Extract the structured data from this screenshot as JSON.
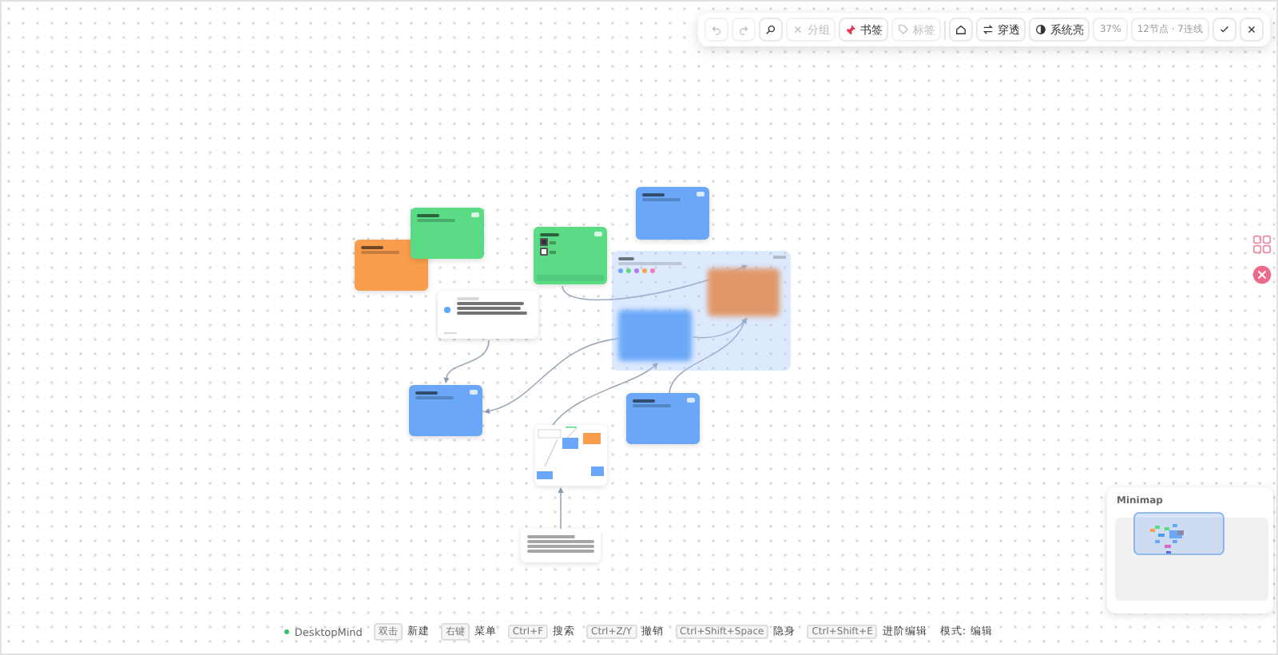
{
  "toolbar": {
    "items": [
      {
        "kind": "icon",
        "disabled": true
      },
      {
        "kind": "icon",
        "disabled": true
      },
      {
        "kind": "icon",
        "disabled": false
      },
      {
        "kind": "text",
        "label": "分组",
        "disabled": true
      },
      {
        "kind": "text",
        "label": "书签",
        "disabled": false
      },
      {
        "kind": "text",
        "label": "标签",
        "disabled": true
      },
      {
        "kind": "icon",
        "disabled": false
      },
      {
        "kind": "text",
        "label": "穿透",
        "disabled": false
      },
      {
        "kind": "text",
        "label": "系统亮",
        "disabled": false
      },
      {
        "kind": "info",
        "label": "37%"
      },
      {
        "kind": "info",
        "label": "12节点 · 7连线"
      },
      {
        "kind": "icon",
        "disabled": false
      },
      {
        "kind": "icon",
        "disabled": false
      }
    ]
  },
  "nodes": [
    {
      "kind": "note",
      "color": "#f79d4b"
    },
    {
      "kind": "note",
      "color": "#5bdb86"
    },
    {
      "kind": "todo",
      "color": "#5bdb86",
      "tasks": [
        {
          "checked": true
        },
        {
          "checked": false
        }
      ]
    },
    {
      "kind": "note",
      "color": "#6aa8f7"
    },
    {
      "kind": "group",
      "swatches": [
        {
          "color": "#6aa8f7"
        },
        {
          "color": "#5bdb86"
        },
        {
          "color": "#b57bf2"
        },
        {
          "color": "#f7a64b"
        },
        {
          "color": "#f27bc0"
        }
      ]
    },
    {
      "kind": "blurred",
      "color": "#e0986a"
    },
    {
      "kind": "blurred",
      "color": "#6aa8f7"
    },
    {
      "kind": "link"
    },
    {
      "kind": "note",
      "color": "#6aa8f7"
    },
    {
      "kind": "note",
      "color": "#6aa8f7"
    },
    {
      "kind": "board"
    },
    {
      "kind": "text"
    }
  ],
  "status_bar": {
    "app": "DesktopMind",
    "hints": [
      {
        "key": "双击",
        "action": "新建"
      },
      {
        "key": "右键",
        "action": "菜单"
      },
      {
        "key": "Ctrl+F",
        "action": "搜索"
      },
      {
        "key": "Ctrl+Z/Y",
        "action": "撤销"
      },
      {
        "key": "Ctrl+Shift+Space",
        "action": "隐身"
      },
      {
        "key": "Ctrl+Shift+E",
        "action": "进阶编辑"
      }
    ],
    "mode_label": "模式:",
    "mode": "编辑"
  },
  "minimap": {
    "title": "Minimap"
  }
}
